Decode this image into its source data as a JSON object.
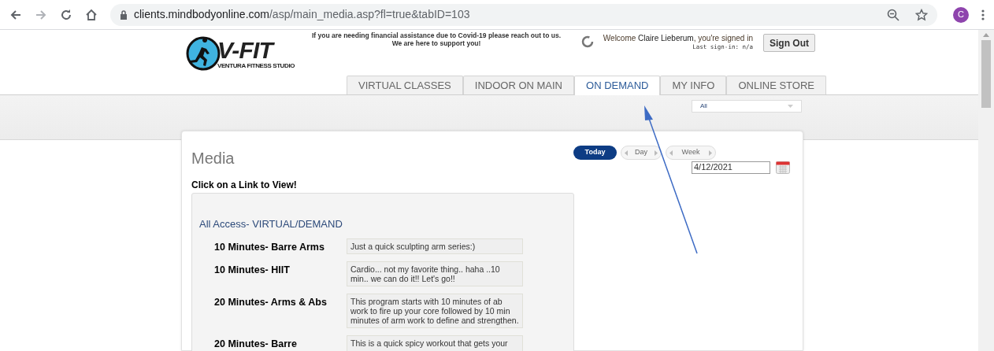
{
  "browser": {
    "url_host": "clients.mindbodyonline.com",
    "url_path": "/asp/main_media.asp?fl=true&tabID=103",
    "profile_initial": "C"
  },
  "header": {
    "logo": {
      "title": "V-FIT",
      "subtitle": "VENTURA FITNESS STUDIO"
    },
    "notice": [
      "If you are needing financial assistance due to Covid-19 please reach out to us.",
      "We are here to support you!"
    ],
    "welcome": {
      "prefix": "Welcome ",
      "name": "Claire Lieberum",
      "suffix": ", you're signed in",
      "last_signin": "Last sign-in: n/a"
    },
    "sign_out": "Sign Out"
  },
  "tabs": [
    {
      "label": "VIRTUAL CLASSES",
      "selected": false
    },
    {
      "label": "INDOOR ON MAIN",
      "selected": false
    },
    {
      "label": "ON DEMAND",
      "selected": true
    },
    {
      "label": "MY INFO",
      "selected": false
    },
    {
      "label": "ONLINE STORE",
      "selected": false
    }
  ],
  "filter": {
    "value": "All"
  },
  "media": {
    "title": "Media",
    "nav": {
      "today": "Today",
      "day": "Day",
      "week": "Week"
    },
    "date": "4/12/2021",
    "instruction": "Click on a Link to View!",
    "category": "All Access- VIRTUAL/DEMAND",
    "items": [
      {
        "title": "10 Minutes- Barre Arms",
        "description": "Just a quick sculpting arm series:)"
      },
      {
        "title": "10 Minutes- HIIT",
        "description": "Cardio... not my favorite thing.. haha ..10 min.. we can do it!! Let's go!!"
      },
      {
        "title": "20 Minutes- Arms & Abs",
        "description": "This program starts with 10 minutes of ab work to fire up your core followed by 10 min minutes of arm work to define and strengthen."
      },
      {
        "title": "20 Minutes- Barre",
        "description": "This is a quick spicy workout that gets your"
      }
    ]
  }
}
